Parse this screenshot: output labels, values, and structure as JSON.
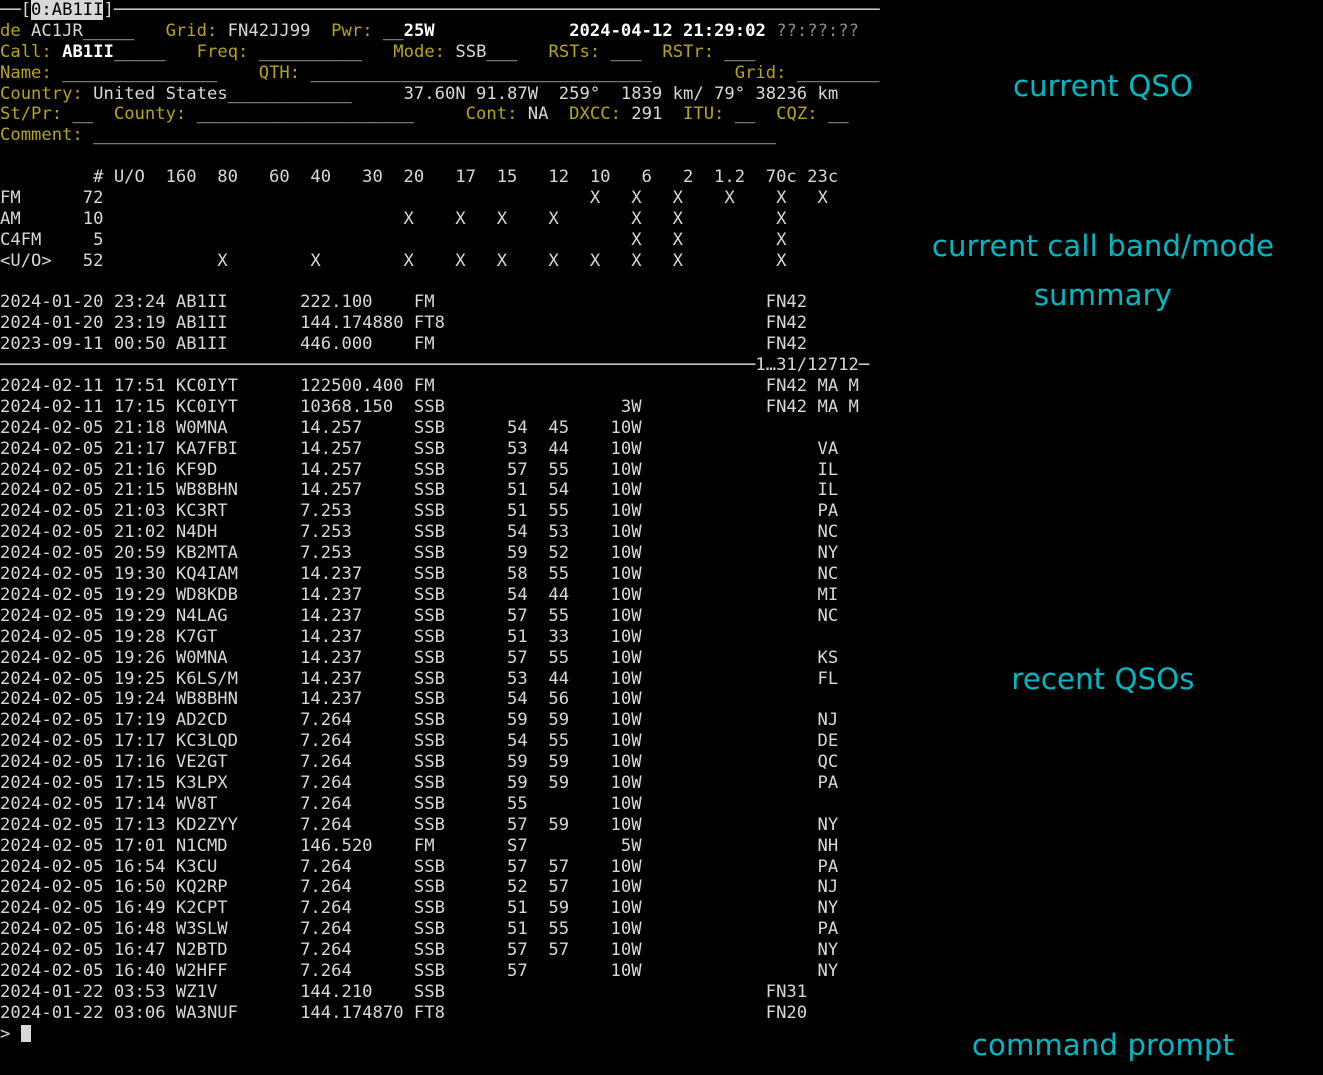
{
  "window": {
    "title_prefix": "—[",
    "title": "0:AB1II",
    "title_suffix": "]",
    "rule_char": "─"
  },
  "colors": {
    "background": "#000000",
    "foreground": "#d8d8d8",
    "bright": "#ffffff",
    "label": "#b8a41c",
    "dim": "#8a8a8a",
    "accent": "#00b8c4"
  },
  "qso_form": {
    "de_label": "de",
    "de_value": "AC1JR_____",
    "grid_label": "Grid:",
    "grid_value": "FN42JJ99",
    "pwr_label": "Pwr:",
    "pwr_value": "__25W",
    "date": "2024-04-12",
    "time": "21:29:02",
    "time_alt": "??:??:??",
    "call_label": "Call:",
    "call_value": "AB1II",
    "call_fill": "_____",
    "freq_label": "Freq:",
    "freq_value": "__________",
    "mode_label": "Mode:",
    "mode_value": "SSB___",
    "rsts_label": "RSTs:",
    "rsts_value": "___",
    "rstr_label": "RSTr:",
    "rstr_value": "___",
    "name_label": "Name:",
    "name_value": "_______________",
    "qth_label": "QTH:",
    "qth_value": "_________________________________",
    "grid2_label": "Grid:",
    "grid2_value": "________",
    "country_label": "Country:",
    "country_value": "United States____________",
    "latitude": "37.60N",
    "longitude": "91.87W",
    "bearing_short": "259°",
    "distance_short": "1839 km/",
    "bearing_long": "79°",
    "distance_long": "38236 km",
    "stpr_label": "St/Pr:",
    "stpr_value": "__",
    "county_label": "County:",
    "county_value": "_____________________",
    "cont_label": "Cont:",
    "cont_value": "NA",
    "dxcc_label": "DXCC:",
    "dxcc_value": "291",
    "itu_label": "ITU:",
    "itu_value": "__",
    "cqz_label": "CQZ:",
    "cqz_value": "__",
    "comment_label": "Comment:",
    "comment_value": "__________________________________________________________________"
  },
  "band_summary": {
    "header": [
      "#",
      "U/O",
      "160",
      "80",
      "60",
      "40",
      "30",
      "20",
      "17",
      "15",
      "12",
      "10",
      "6",
      "2",
      "1.2",
      "70c",
      "23c"
    ],
    "mark": "X",
    "rows": [
      {
        "mode": "FM",
        "count": "72",
        "bands": [
          "",
          "",
          "",
          "",
          "",
          "",
          "",
          "",
          "",
          "X",
          "X",
          "X",
          "X",
          "X",
          "X"
        ]
      },
      {
        "mode": "AM",
        "count": "10",
        "bands": [
          "",
          "",
          "",
          "",
          "",
          "X",
          "X",
          "X",
          "X",
          "",
          "X",
          "X",
          "",
          "X",
          ""
        ]
      },
      {
        "mode": "C4FM",
        "count": "5",
        "bands": [
          "",
          "",
          "",
          "",
          "",
          "",
          "",
          "",
          "",
          "",
          "X",
          "X",
          "",
          "X",
          ""
        ]
      },
      {
        "mode": "<U/O>",
        "count": "52",
        "bands": [
          "",
          "X",
          "",
          "X",
          "",
          "X",
          "X",
          "X",
          "X",
          "X",
          "X",
          "X",
          "",
          "X",
          ""
        ]
      }
    ]
  },
  "current_call_qsos": [
    {
      "date": "2024-01-20",
      "time": "23:24",
      "call": "AB1II",
      "freq": "222.100",
      "mode": "FM",
      "rsts": "",
      "rstr": "",
      "pwr": "",
      "grid": "FN42",
      "state": "",
      "extra": ""
    },
    {
      "date": "2024-01-20",
      "time": "23:19",
      "call": "AB1II",
      "freq": "144.174880",
      "mode": "FT8",
      "rsts": "",
      "rstr": "",
      "pwr": "",
      "grid": "FN42",
      "state": "",
      "extra": ""
    },
    {
      "date": "2023-09-11",
      "time": "00:50",
      "call": "AB1II",
      "freq": "446.000",
      "mode": "FM",
      "rsts": "",
      "rstr": "",
      "pwr": "",
      "grid": "FN42",
      "state": "",
      "extra": ""
    }
  ],
  "separator": {
    "range_label": "1…31/12712",
    "trailing": "─"
  },
  "recent_qsos": [
    {
      "date": "2024-02-11",
      "time": "17:51",
      "call": "KC0IYT",
      "freq": "122500.400",
      "mode": "FM",
      "rsts": "",
      "rstr": "",
      "pwr": "",
      "grid": "FN42 MA M",
      "state": ""
    },
    {
      "date": "2024-02-11",
      "time": "17:15",
      "call": "KC0IYT",
      "freq": "10368.150",
      "mode": "SSB",
      "rsts": "",
      "rstr": "",
      "pwr": "3W",
      "grid": "FN42 MA M",
      "state": ""
    },
    {
      "date": "2024-02-05",
      "time": "21:18",
      "call": "W0MNA",
      "freq": "14.257",
      "mode": "SSB",
      "rsts": "54",
      "rstr": "45",
      "pwr": "10W",
      "grid": "",
      "state": ""
    },
    {
      "date": "2024-02-05",
      "time": "21:17",
      "call": "KA7FBI",
      "freq": "14.257",
      "mode": "SSB",
      "rsts": "53",
      "rstr": "44",
      "pwr": "10W",
      "grid": "",
      "state": "VA"
    },
    {
      "date": "2024-02-05",
      "time": "21:16",
      "call": "KF9D",
      "freq": "14.257",
      "mode": "SSB",
      "rsts": "57",
      "rstr": "55",
      "pwr": "10W",
      "grid": "",
      "state": "IL"
    },
    {
      "date": "2024-02-05",
      "time": "21:15",
      "call": "WB8BHN",
      "freq": "14.257",
      "mode": "SSB",
      "rsts": "51",
      "rstr": "54",
      "pwr": "10W",
      "grid": "",
      "state": "IL"
    },
    {
      "date": "2024-02-05",
      "time": "21:03",
      "call": "KC3RT",
      "freq": "7.253",
      "mode": "SSB",
      "rsts": "51",
      "rstr": "55",
      "pwr": "10W",
      "grid": "",
      "state": "PA"
    },
    {
      "date": "2024-02-05",
      "time": "21:02",
      "call": "N4DH",
      "freq": "7.253",
      "mode": "SSB",
      "rsts": "54",
      "rstr": "53",
      "pwr": "10W",
      "grid": "",
      "state": "NC"
    },
    {
      "date": "2024-02-05",
      "time": "20:59",
      "call": "KB2MTA",
      "freq": "7.253",
      "mode": "SSB",
      "rsts": "59",
      "rstr": "52",
      "pwr": "10W",
      "grid": "",
      "state": "NY"
    },
    {
      "date": "2024-02-05",
      "time": "19:30",
      "call": "KQ4IAM",
      "freq": "14.237",
      "mode": "SSB",
      "rsts": "58",
      "rstr": "55",
      "pwr": "10W",
      "grid": "",
      "state": "NC"
    },
    {
      "date": "2024-02-05",
      "time": "19:29",
      "call": "WD8KDB",
      "freq": "14.237",
      "mode": "SSB",
      "rsts": "54",
      "rstr": "44",
      "pwr": "10W",
      "grid": "",
      "state": "MI"
    },
    {
      "date": "2024-02-05",
      "time": "19:29",
      "call": "N4LAG",
      "freq": "14.237",
      "mode": "SSB",
      "rsts": "57",
      "rstr": "55",
      "pwr": "10W",
      "grid": "",
      "state": "NC"
    },
    {
      "date": "2024-02-05",
      "time": "19:28",
      "call": "K7GT",
      "freq": "14.237",
      "mode": "SSB",
      "rsts": "51",
      "rstr": "33",
      "pwr": "10W",
      "grid": "",
      "state": ""
    },
    {
      "date": "2024-02-05",
      "time": "19:26",
      "call": "W0MNA",
      "freq": "14.237",
      "mode": "SSB",
      "rsts": "57",
      "rstr": "55",
      "pwr": "10W",
      "grid": "",
      "state": "KS"
    },
    {
      "date": "2024-02-05",
      "time": "19:25",
      "call": "K6LS/M",
      "freq": "14.237",
      "mode": "SSB",
      "rsts": "53",
      "rstr": "44",
      "pwr": "10W",
      "grid": "",
      "state": "FL"
    },
    {
      "date": "2024-02-05",
      "time": "19:24",
      "call": "WB8BHN",
      "freq": "14.237",
      "mode": "SSB",
      "rsts": "54",
      "rstr": "56",
      "pwr": "10W",
      "grid": "",
      "state": ""
    },
    {
      "date": "2024-02-05",
      "time": "17:19",
      "call": "AD2CD",
      "freq": "7.264",
      "mode": "SSB",
      "rsts": "59",
      "rstr": "59",
      "pwr": "10W",
      "grid": "",
      "state": "NJ"
    },
    {
      "date": "2024-02-05",
      "time": "17:17",
      "call": "KC3LQD",
      "freq": "7.264",
      "mode": "SSB",
      "rsts": "54",
      "rstr": "55",
      "pwr": "10W",
      "grid": "",
      "state": "DE"
    },
    {
      "date": "2024-02-05",
      "time": "17:16",
      "call": "VE2GT",
      "freq": "7.264",
      "mode": "SSB",
      "rsts": "59",
      "rstr": "59",
      "pwr": "10W",
      "grid": "",
      "state": "QC"
    },
    {
      "date": "2024-02-05",
      "time": "17:15",
      "call": "K3LPX",
      "freq": "7.264",
      "mode": "SSB",
      "rsts": "59",
      "rstr": "59",
      "pwr": "10W",
      "grid": "",
      "state": "PA"
    },
    {
      "date": "2024-02-05",
      "time": "17:14",
      "call": "WV8T",
      "freq": "7.264",
      "mode": "SSB",
      "rsts": "55",
      "rstr": "",
      "pwr": "10W",
      "grid": "",
      "state": ""
    },
    {
      "date": "2024-02-05",
      "time": "17:13",
      "call": "KD2ZYY",
      "freq": "7.264",
      "mode": "SSB",
      "rsts": "57",
      "rstr": "59",
      "pwr": "10W",
      "grid": "",
      "state": "NY"
    },
    {
      "date": "2024-02-05",
      "time": "17:01",
      "call": "N1CMD",
      "freq": "146.520",
      "mode": "FM",
      "rsts": "S7",
      "rstr": "",
      "pwr": "5W",
      "grid": "",
      "state": "NH"
    },
    {
      "date": "2024-02-05",
      "time": "16:54",
      "call": "K3CU",
      "freq": "7.264",
      "mode": "SSB",
      "rsts": "57",
      "rstr": "57",
      "pwr": "10W",
      "grid": "",
      "state": "PA"
    },
    {
      "date": "2024-02-05",
      "time": "16:50",
      "call": "KQ2RP",
      "freq": "7.264",
      "mode": "SSB",
      "rsts": "52",
      "rstr": "57",
      "pwr": "10W",
      "grid": "",
      "state": "NJ"
    },
    {
      "date": "2024-02-05",
      "time": "16:49",
      "call": "K2CPT",
      "freq": "7.264",
      "mode": "SSB",
      "rsts": "51",
      "rstr": "59",
      "pwr": "10W",
      "grid": "",
      "state": "NY"
    },
    {
      "date": "2024-02-05",
      "time": "16:48",
      "call": "W3SLW",
      "freq": "7.264",
      "mode": "SSB",
      "rsts": "51",
      "rstr": "55",
      "pwr": "10W",
      "grid": "",
      "state": "PA"
    },
    {
      "date": "2024-02-05",
      "time": "16:47",
      "call": "N2BTD",
      "freq": "7.264",
      "mode": "SSB",
      "rsts": "57",
      "rstr": "57",
      "pwr": "10W",
      "grid": "",
      "state": "NY"
    },
    {
      "date": "2024-02-05",
      "time": "16:40",
      "call": "W2HFF",
      "freq": "7.264",
      "mode": "SSB",
      "rsts": "57",
      "rstr": "",
      "pwr": "10W",
      "grid": "",
      "state": "NY"
    },
    {
      "date": "2024-01-22",
      "time": "03:53",
      "call": "WZ1V",
      "freq": "144.210",
      "mode": "SSB",
      "rsts": "",
      "rstr": "",
      "pwr": "",
      "grid": "FN31",
      "state": ""
    },
    {
      "date": "2024-01-22",
      "time": "03:06",
      "call": "WA3NUF",
      "freq": "144.174870",
      "mode": "FT8",
      "rsts": "",
      "rstr": "",
      "pwr": "",
      "grid": "FN20",
      "state": ""
    }
  ],
  "prompt": {
    "symbol": ">",
    "input_value": ""
  },
  "annotations": [
    {
      "id": "current-qso",
      "text": "current QSO"
    },
    {
      "id": "band-summary",
      "text": "current call band/mode\nsummary"
    },
    {
      "id": "recent-qsos",
      "text": "recent QSOs"
    },
    {
      "id": "command-prompt",
      "text": "command prompt"
    }
  ]
}
